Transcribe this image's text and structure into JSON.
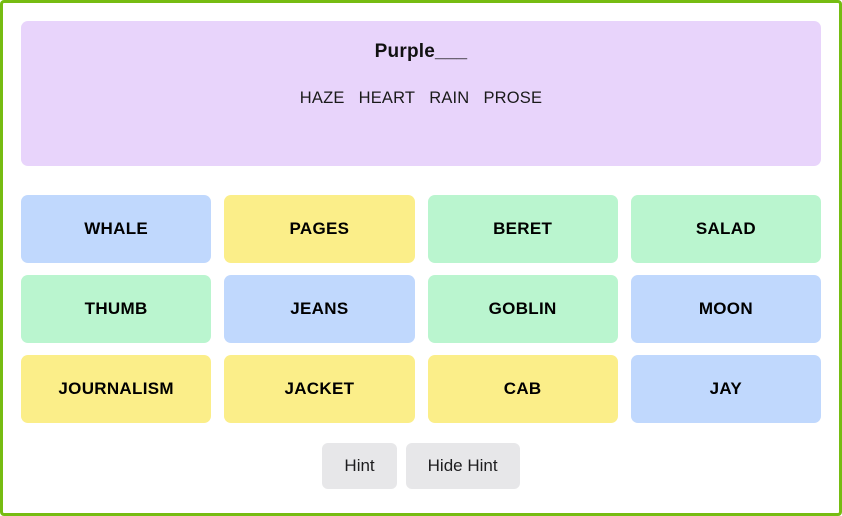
{
  "theme": {
    "page_border_color": "#76bc12",
    "hint_banner_color": "#e8d4fb",
    "tile_blue": "#c0d8fd",
    "tile_yellow": "#fbee89",
    "tile_green": "#baf5cf",
    "button_bg": "#e7e7e9"
  },
  "hint": {
    "title": "Purple___",
    "words": [
      "HAZE",
      "HEART",
      "RAIN",
      "PROSE"
    ]
  },
  "grid": {
    "tiles": [
      {
        "label": "WHALE",
        "color": "blue"
      },
      {
        "label": "PAGES",
        "color": "yellow"
      },
      {
        "label": "BERET",
        "color": "green"
      },
      {
        "label": "SALAD",
        "color": "green"
      },
      {
        "label": "THUMB",
        "color": "green"
      },
      {
        "label": "JEANS",
        "color": "blue"
      },
      {
        "label": "GOBLIN",
        "color": "green"
      },
      {
        "label": "MOON",
        "color": "blue"
      },
      {
        "label": "JOURNALISM",
        "color": "yellow"
      },
      {
        "label": "JACKET",
        "color": "yellow"
      },
      {
        "label": "CAB",
        "color": "yellow"
      },
      {
        "label": "JAY",
        "color": "blue"
      }
    ]
  },
  "controls": {
    "hint_label": "Hint",
    "hide_hint_label": "Hide Hint"
  }
}
